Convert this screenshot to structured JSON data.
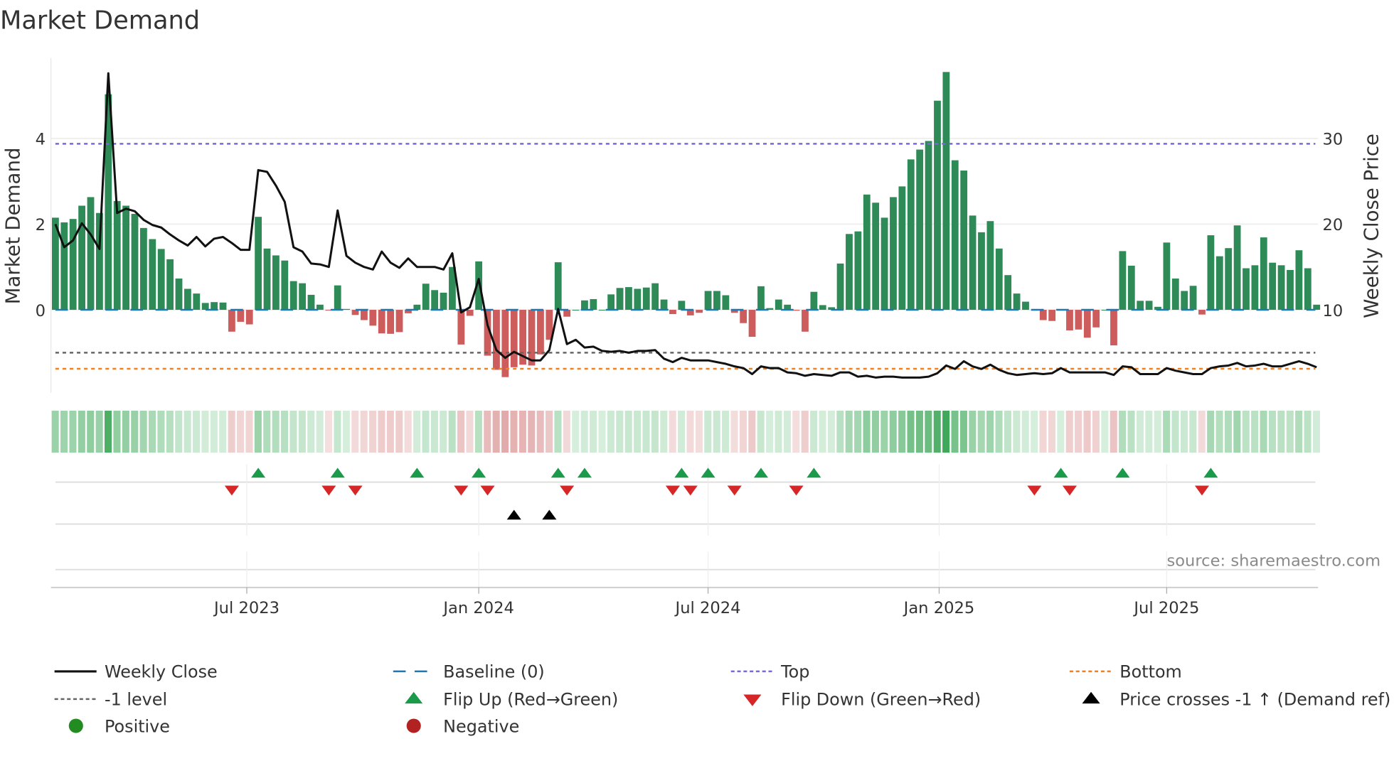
{
  "chart_data": {
    "type": "bar",
    "title": "Market Demand",
    "ylabel": "Market Demand",
    "y2label": "Weekly Close Price",
    "ylim": [
      -1.9,
      5.9
    ],
    "y2lim": [
      0.5,
      39.5
    ],
    "yticks": [
      "0",
      "2",
      "4"
    ],
    "y2ticks": [
      "10",
      "20",
      "30"
    ],
    "xticks": [
      {
        "label": "Jul 2023",
        "at": 21.7
      },
      {
        "label": "Jan 2024",
        "at": 48.0
      },
      {
        "label": "Jul 2024",
        "at": 74.0
      },
      {
        "label": "Jan 2025",
        "at": 100.2
      },
      {
        "label": "Jul 2025",
        "at": 126.0
      }
    ],
    "x_unit": "week index",
    "reference_lines": {
      "baseline": 0,
      "top": 3.875,
      "minus_one": -1,
      "bottom": -1.375
    },
    "demand": [
      2.15,
      2.04,
      2.12,
      2.43,
      2.63,
      2.26,
      5.03,
      2.54,
      2.43,
      2.24,
      1.91,
      1.65,
      1.42,
      1.18,
      0.73,
      0.49,
      0.38,
      0.16,
      0.18,
      0.17,
      -0.51,
      -0.28,
      -0.34,
      2.17,
      1.43,
      1.27,
      1.15,
      0.67,
      0.62,
      0.35,
      0.12,
      -0.01,
      0.57,
      0.02,
      -0.12,
      -0.24,
      -0.37,
      -0.55,
      -0.56,
      -0.52,
      -0.08,
      0.12,
      0.61,
      0.46,
      0.4,
      1.0,
      -0.81,
      -0.14,
      1.13,
      -1.07,
      -1.4,
      -1.57,
      -1.34,
      -1.28,
      -1.3,
      -1.04,
      -0.7,
      1.11,
      -0.16,
      0,
      0.22,
      0.25,
      0,
      0.36,
      0.51,
      0.53,
      0.49,
      0.52,
      0.62,
      0.24,
      -0.1,
      0.21,
      -0.13,
      -0.07,
      0.44,
      0.44,
      0.34,
      -0.07,
      -0.31,
      -0.63,
      0.55,
      0.04,
      0.24,
      0.12,
      -0.02,
      -0.51,
      0.42,
      0.11,
      0.06,
      1.08,
      1.77,
      1.83,
      2.69,
      2.5,
      2.15,
      2.63,
      2.88,
      3.51,
      3.74,
      3.94,
      4.88,
      5.55,
      3.49,
      3.25,
      2.2,
      1.81,
      2.07,
      1.43,
      0.81,
      0.38,
      0.19,
      0,
      -0.24,
      -0.26,
      0,
      -0.48,
      -0.46,
      -0.65,
      -0.41,
      0,
      -0.83,
      1.37,
      1.03,
      0.21,
      0.21,
      0.07,
      1.57,
      0.73,
      0.44,
      0.56,
      -0.11,
      1.74,
      1.25,
      1.44,
      1.97,
      0.97,
      1.04,
      1.69,
      1.1,
      1.04,
      0.93,
      1.39,
      0.97,
      0.12
    ],
    "price": [
      20.0,
      17.3,
      18.1,
      20.1,
      18.8,
      17.1,
      37.6,
      21.3,
      21.8,
      21.5,
      20.5,
      19.9,
      19.6,
      18.8,
      18.1,
      17.5,
      18.5,
      17.4,
      18.3,
      18.5,
      17.8,
      17.0,
      17.0,
      26.3,
      26.1,
      24.5,
      22.6,
      17.3,
      16.8,
      15.4,
      15.3,
      15.0,
      21.6,
      16.3,
      15.5,
      15.0,
      14.7,
      16.8,
      15.5,
      14.9,
      16.0,
      15.0,
      15.0,
      15.0,
      14.7,
      16.6,
      9.7,
      10.3,
      13.6,
      8.2,
      5.3,
      4.4,
      5.1,
      4.6,
      4.1,
      4.1,
      5.3,
      10.1,
      6.0,
      6.5,
      5.6,
      5.7,
      5.2,
      5.1,
      5.2,
      5.0,
      5.2,
      5.2,
      5.3,
      4.3,
      3.9,
      4.4,
      4.1,
      4.1,
      4.1,
      3.9,
      3.7,
      3.4,
      3.2,
      2.5,
      3.4,
      3.2,
      3.2,
      2.7,
      2.6,
      2.3,
      2.5,
      2.4,
      2.3,
      2.7,
      2.7,
      2.2,
      2.3,
      2.1,
      2.2,
      2.2,
      2.1,
      2.1,
      2.1,
      2.2,
      2.6,
      3.5,
      3.1,
      4.0,
      3.4,
      3.1,
      3.6,
      3.0,
      2.6,
      2.4,
      2.5,
      2.6,
      2.5,
      2.6,
      3.2,
      2.7,
      2.7,
      2.7,
      2.7,
      2.7,
      2.4,
      3.4,
      3.3,
      2.5,
      2.5,
      2.5,
      3.2,
      2.9,
      2.7,
      2.5,
      2.5,
      3.2,
      3.4,
      3.5,
      3.8,
      3.4,
      3.5,
      3.7,
      3.4,
      3.4,
      3.7,
      4.0,
      3.7,
      3.3
    ],
    "flip_up": [
      23,
      32,
      41,
      48,
      57,
      60,
      71,
      74,
      80,
      86,
      114,
      121,
      131
    ],
    "flip_down": [
      20,
      31,
      34,
      46,
      49,
      58,
      70,
      72,
      77,
      84,
      111,
      115,
      130
    ],
    "price_cross": [
      52,
      56
    ],
    "colors": {
      "positive_bar": "#2e8b57",
      "negative_bar": "#cd5c5c",
      "price": "#111111",
      "baseline": "#1f77b4",
      "top": "#7b68d8",
      "minus_one": "#666666",
      "bottom": "#f08020",
      "flip_up": "#1a9a4a",
      "flip_down": "#d62728",
      "cross": "#000000",
      "positive_dot": "#228b22",
      "negative_dot": "#b22222"
    },
    "source": "source: sharemaestro.com",
    "legend": {
      "weekly_close": "Weekly Close",
      "baseline": "Baseline (0)",
      "top": "Top",
      "bottom": "Bottom",
      "minus_one": "-1 level",
      "flip_up": "Flip Up (Red→Green)",
      "flip_down": "Flip Down (Green→Red)",
      "price_cross": "Price crosses -1 ↑ (Demand ref)",
      "positive": "Positive",
      "negative": "Negative"
    }
  }
}
